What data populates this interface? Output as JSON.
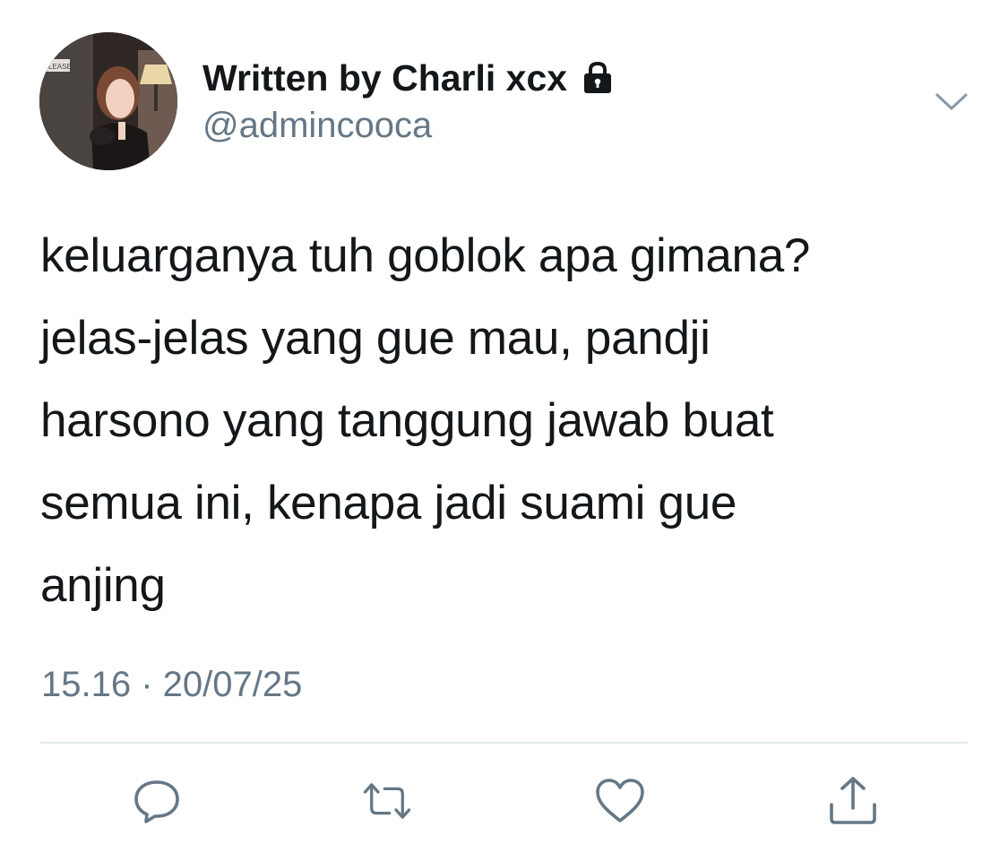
{
  "author": {
    "display_name": "Written by Charli xcx",
    "handle": "@admincooca",
    "protected_icon": "lock-icon",
    "avatar_label": "LEASE"
  },
  "tweet": {
    "lines": [
      "keluarganya tuh goblok apa gimana?",
      "jelas-jelas yang gue mau, pandji",
      "harsono yang tanggung jawab buat",
      "semua ini, kenapa jadi suami gue",
      "anjing"
    ],
    "timestamp": "15.16 · 20/07/25"
  },
  "actions": {
    "reply": "reply-icon",
    "retweet": "retweet-icon",
    "like": "heart-icon",
    "share": "share-icon"
  },
  "colors": {
    "text": "#14171a",
    "secondary": "#657786",
    "divider": "#e1e8ed",
    "icon": "#657786"
  }
}
